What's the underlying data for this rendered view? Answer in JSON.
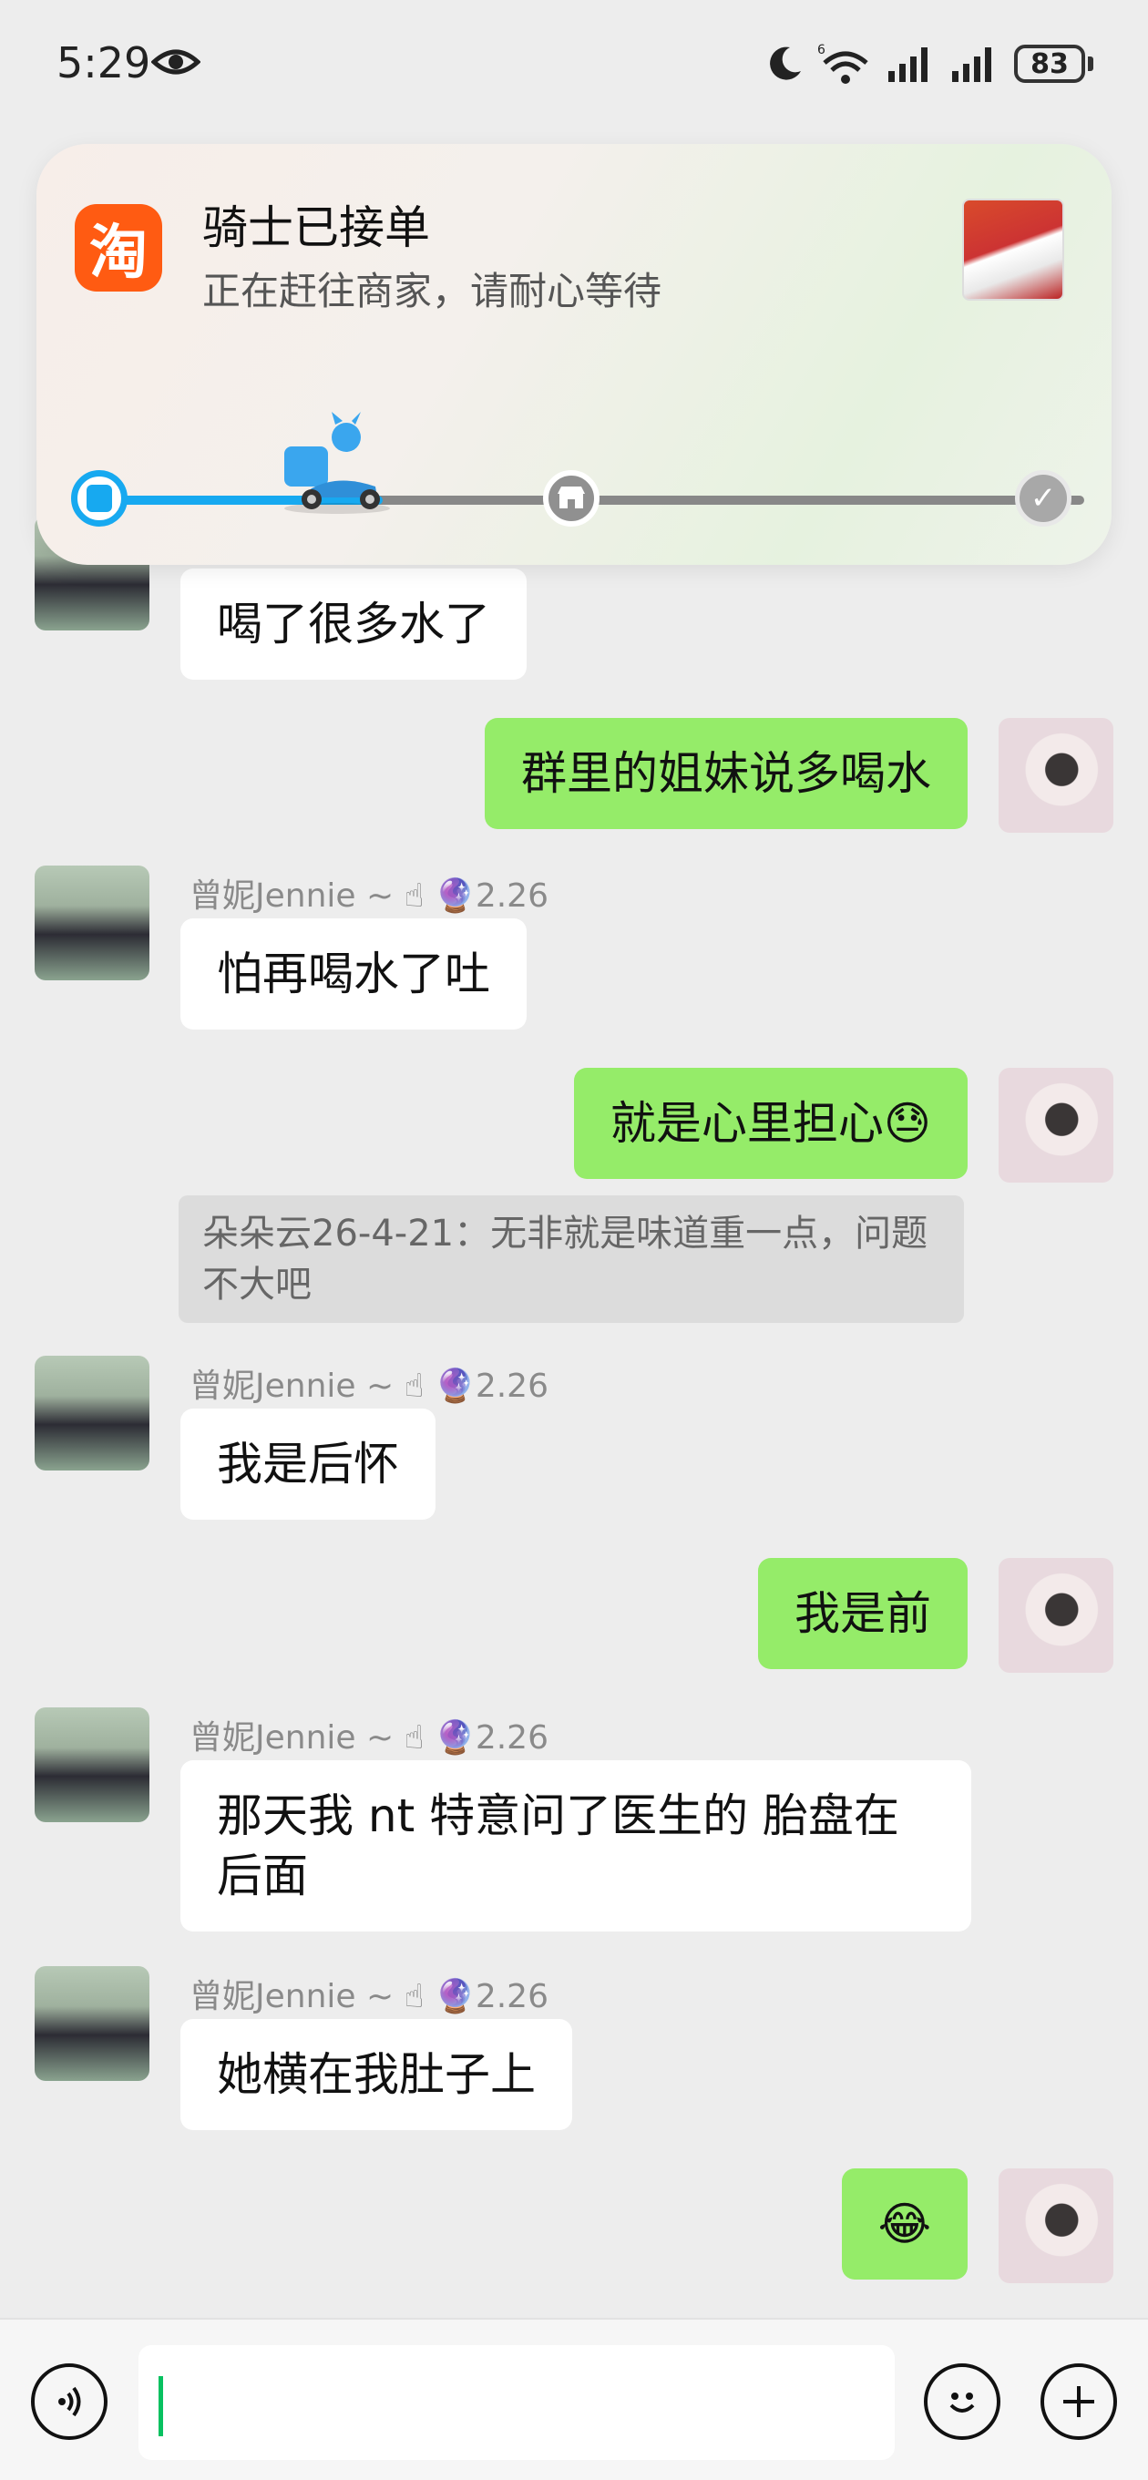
{
  "status_bar": {
    "time": "5:29",
    "battery": "83",
    "icons": [
      "eye-icon",
      "moon-icon",
      "wifi-6-icon",
      "signal-icon",
      "signal-icon",
      "battery-icon"
    ]
  },
  "notification": {
    "app_icon_text": "淘",
    "title": "骑士已接单",
    "subtitle": "正在赶往商家，请耐心等待",
    "progress": 0.28,
    "steps": [
      "order-icon",
      "store-icon",
      "check-icon"
    ],
    "accent_color": "#17a9f0"
  },
  "messages": [
    {
      "from": "other",
      "sender": "",
      "text": "喝了很多水了"
    },
    {
      "from": "me",
      "text": "群里的姐妹说多喝水"
    },
    {
      "from": "other",
      "sender": "曾妮Jennie ~",
      "level": "2.26",
      "text": "怕再喝水了吐"
    },
    {
      "from": "me",
      "text": "就是心里担心😓"
    },
    {
      "quote": "朵朵云26-4-21：无非就是味道重一点，问题不大吧"
    },
    {
      "from": "other",
      "sender": "曾妮Jennie ~",
      "level": "2.26",
      "text": "我是后怀"
    },
    {
      "from": "me",
      "text": "我是前"
    },
    {
      "from": "other",
      "sender": "曾妮Jennie ~",
      "level": "2.26",
      "text": "那天我 nt 特意问了医生的 胎盘在后面"
    },
    {
      "from": "other",
      "sender": "曾妮Jennie ~",
      "level": "2.26",
      "text": "她横在我肚子上"
    },
    {
      "from": "me",
      "text": "😂"
    }
  ],
  "colors": {
    "bubble_out": "#95ec69",
    "bubble_in": "#ffffff",
    "background": "#ededed"
  },
  "input": {
    "value": "",
    "icons": [
      "voice-icon",
      "emoji-icon",
      "plus-icon"
    ]
  }
}
